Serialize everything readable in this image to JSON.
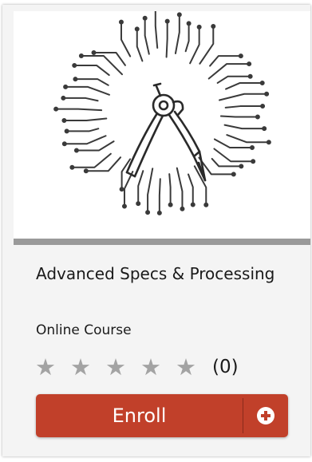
{
  "course": {
    "title": "Advanced Specs & Processing",
    "type": "Online Course",
    "rating": {
      "stars_filled": 0,
      "stars_total": 5,
      "count_text": "(0)",
      "star_glyph": "★",
      "star_color": "#a3a3a3"
    },
    "hero_icon": "compass-circuit-icon"
  },
  "enroll": {
    "label": "Enroll",
    "icon": "plus-circle-icon"
  },
  "colors": {
    "accent": "#c1402a",
    "card_background": "#f4f4f4",
    "divider": "#9a9a9a",
    "text": "#1a1a1a"
  }
}
